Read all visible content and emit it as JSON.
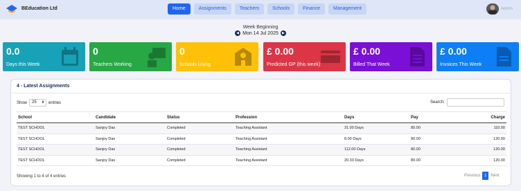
{
  "brand": "BEducation Ltd",
  "nav": [
    "Home",
    "Assignments",
    "Teachers",
    "Schools",
    "Finance",
    "Management"
  ],
  "user": {
    "name": "Admin"
  },
  "week": {
    "label": "Week Beginning",
    "date": "Mon 14 Jul 2025"
  },
  "cards": [
    {
      "value": "0.0",
      "label": "Days this Week",
      "color": "#17a2b8",
      "icon": "calendar-icon"
    },
    {
      "value": "0",
      "label": "Teachers Working",
      "color": "#28a745",
      "icon": "teacher-icon"
    },
    {
      "value": "0",
      "label": "Schools Using",
      "color": "#ffc107",
      "icon": "school-icon"
    },
    {
      "value": "£ 0.00",
      "label": "Predicted GP (this week)",
      "color": "#dc3545",
      "icon": "money-icon"
    },
    {
      "value": "£ 0.00",
      "label": "Billed That Week",
      "color": "#7a0fd8",
      "icon": "document-icon"
    },
    {
      "value": "£ 0.00",
      "label": "Invoices This Week",
      "color": "#0d7ef5",
      "icon": "invoice-icon"
    }
  ],
  "panel": {
    "title": "4 - Latest Assignments",
    "show_label": "Show",
    "show_value": "25",
    "entries_label": "entries",
    "search_label": "Search:",
    "columns": [
      "School",
      "Candidate",
      "Status",
      "Profession",
      "Days",
      "Pay",
      "Charge"
    ],
    "rows": [
      [
        "TEST SCHOOL",
        "Sanjoy Das",
        "Completed",
        "Teaching Assistant",
        "31.00 Days",
        "80.00",
        "110.00"
      ],
      [
        "TEST SCHOOL",
        "Sanjoy Das",
        "Completed",
        "Teaching Assistant",
        "8.00 Days",
        "80.00",
        "120.00"
      ],
      [
        "TEST SCHOOL",
        "Sanjoy Das",
        "Completed",
        "Teaching Assistant",
        "112.00 Days",
        "80.00",
        "120.00"
      ],
      [
        "TEST SCHOOL",
        "Sanjoy Das",
        "Completed",
        "Teaching Assistant",
        "20.33 Days",
        "80.00",
        "120.00"
      ]
    ],
    "info": "Showing 1 to 4 of 4 entries",
    "pager": {
      "prev": "Previous",
      "page": "1",
      "next": "Next"
    }
  }
}
